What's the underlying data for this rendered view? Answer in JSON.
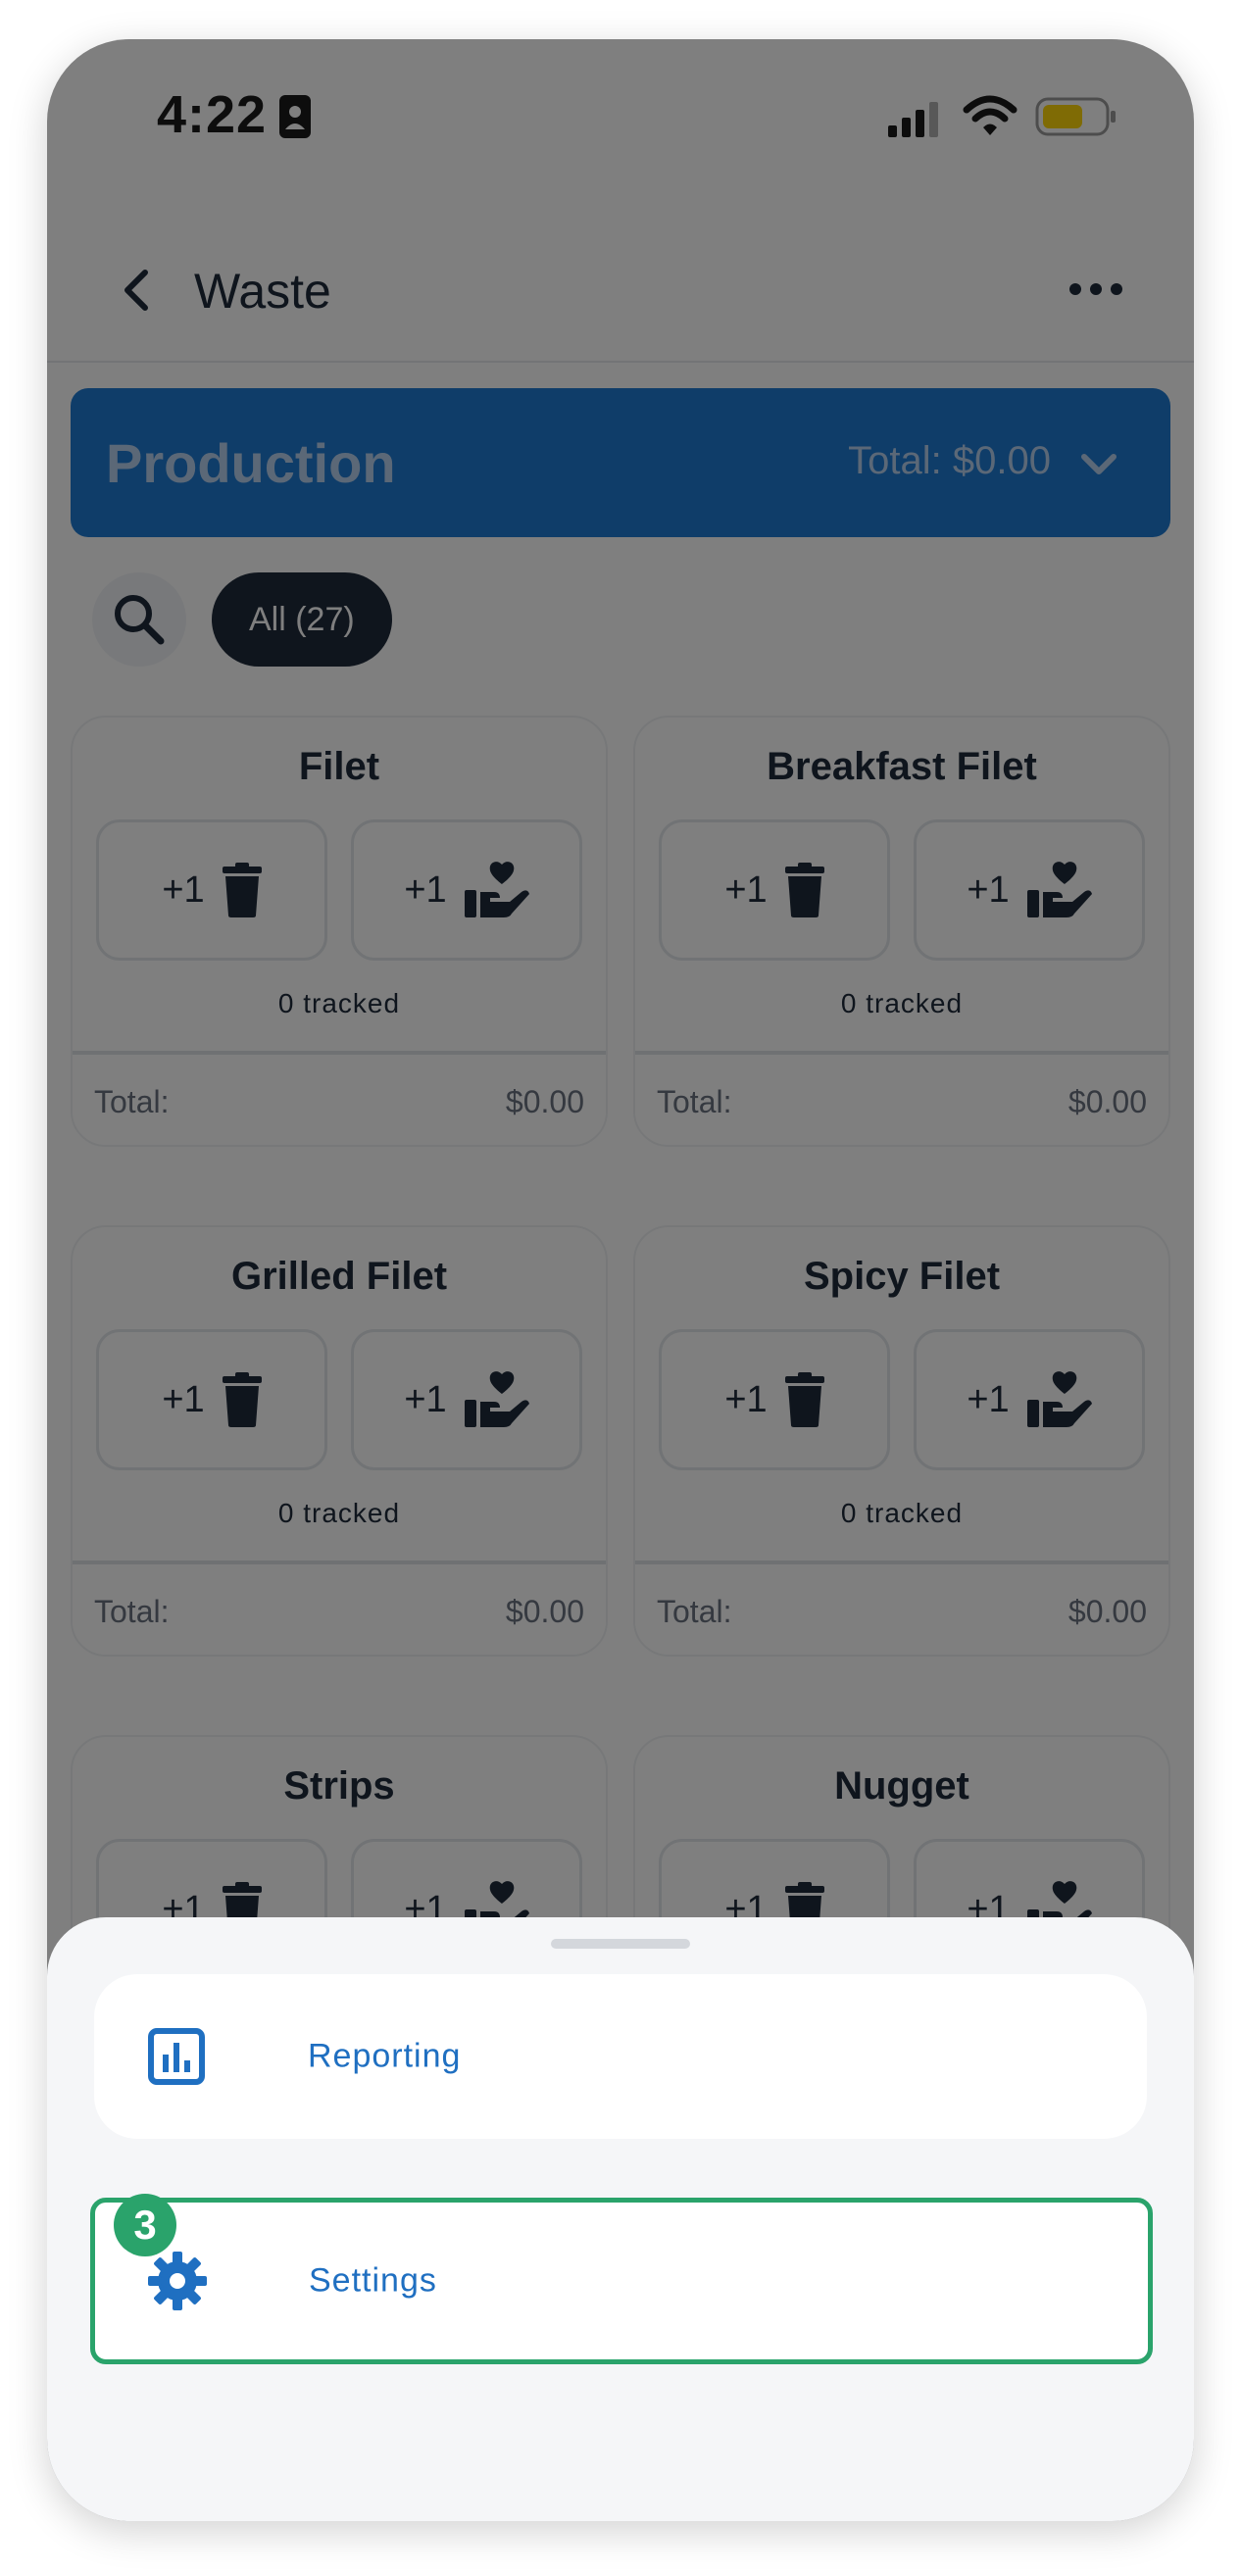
{
  "status_bar": {
    "time": "4:22"
  },
  "header": {
    "title": "Waste"
  },
  "production": {
    "title": "Production",
    "total": "Total: $0.00"
  },
  "filter": {
    "chip_label": "All (27)"
  },
  "cards": [
    {
      "title": "Filet",
      "discard_label": "+1",
      "donate_label": "+1",
      "tracked": "0 tracked",
      "total_label": "Total:",
      "total_value": "$0.00"
    },
    {
      "title": "Breakfast Filet",
      "discard_label": "+1",
      "donate_label": "+1",
      "tracked": "0 tracked",
      "total_label": "Total:",
      "total_value": "$0.00"
    },
    {
      "title": "Grilled Filet",
      "discard_label": "+1",
      "donate_label": "+1",
      "tracked": "0 tracked",
      "total_label": "Total:",
      "total_value": "$0.00"
    },
    {
      "title": "Spicy Filet",
      "discard_label": "+1",
      "donate_label": "+1",
      "tracked": "0 tracked",
      "total_label": "Total:",
      "total_value": "$0.00"
    },
    {
      "title": "Strips",
      "discard_label": "+1",
      "donate_label": "+1"
    },
    {
      "title": "Nugget",
      "discard_label": "+1",
      "donate_label": "+1"
    }
  ],
  "sheet": {
    "items": [
      {
        "label": "Reporting",
        "icon": "bar-chart-icon"
      },
      {
        "label": "Settings",
        "icon": "gear-icon"
      }
    ],
    "step_badge": "3"
  },
  "colors": {
    "accent_blue": "#1f7ad3",
    "dark_navy": "#1e2a3b",
    "highlight_green": "#2aa36b",
    "link_blue": "#1f6fc1"
  }
}
